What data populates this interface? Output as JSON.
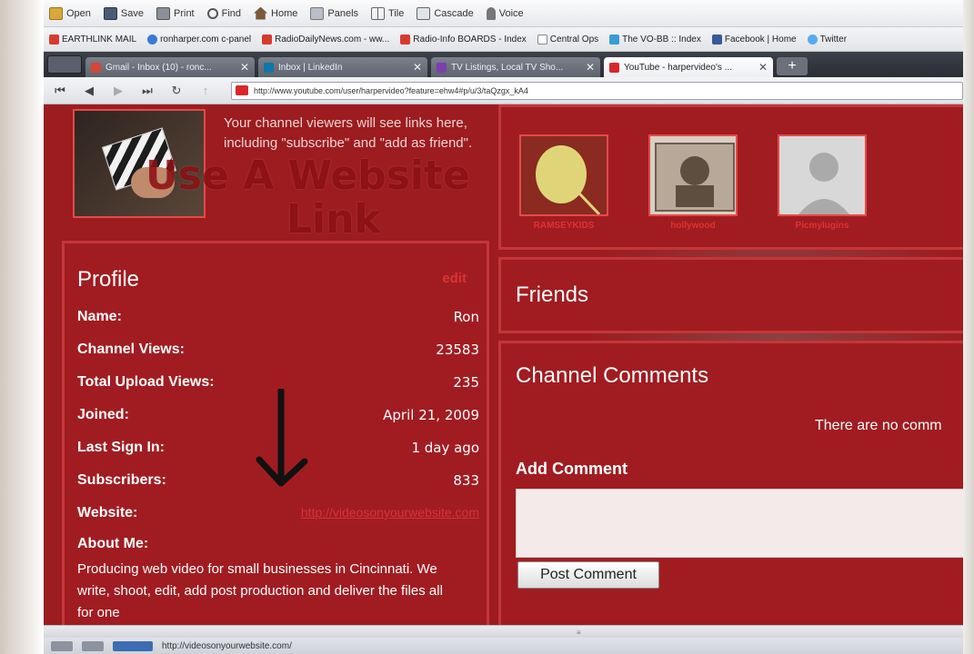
{
  "toolbar": {
    "open": "Open",
    "save": "Save",
    "print": "Print",
    "find": "Find",
    "home": "Home",
    "panels": "Panels",
    "tile": "Tile",
    "cascade": "Cascade",
    "voice": "Voice"
  },
  "bookmarks": [
    {
      "label": "EARTHLINK MAIL",
      "color": "#d83a2e"
    },
    {
      "label": "ronharper.com c-panel",
      "color": "#3a7bd5"
    },
    {
      "label": "RadioDailyNews.com - ww...",
      "color": "#d83a2e"
    },
    {
      "label": "Radio-Info BOARDS - Index",
      "color": "#d83a2e"
    },
    {
      "label": "Central Ops",
      "color": "#888888"
    },
    {
      "label": "The VO-BB :: Index",
      "color": "#3a9bd5"
    },
    {
      "label": "Facebook | Home",
      "color": "#3b5998"
    },
    {
      "label": "Twitter",
      "color": "#55acee"
    }
  ],
  "tabs": [
    {
      "label": "Gmail - Inbox (10) - ronc...",
      "color": "#d44638",
      "active": false
    },
    {
      "label": "Inbox | LinkedIn",
      "color": "#0e76a8",
      "active": false
    },
    {
      "label": "TV Listings, Local TV Sho...",
      "color": "#7b3fb0",
      "active": false
    },
    {
      "label": "YouTube - harpervideo's ...",
      "color": "#d8282a",
      "active": true
    }
  ],
  "address": {
    "url": "http://www.youtube.com/user/harpervideo?feature=ehw4#p/u/3/taQzgx_kA4"
  },
  "channel": {
    "intro": "Your channel viewers will see links here, including \"subscribe\" and \"add as friend\".",
    "overlay_line1": "Use A Website",
    "overlay_line2": "Link"
  },
  "profile": {
    "title": "Profile",
    "edit": "edit",
    "rows": [
      {
        "key": "Name:",
        "value": "Ron"
      },
      {
        "key": "Channel Views:",
        "value": "23583"
      },
      {
        "key": "Total Upload Views:",
        "value": "235"
      },
      {
        "key": "Joined:",
        "value": "April 21, 2009"
      },
      {
        "key": "Last Sign In:",
        "value": "1 day ago"
      },
      {
        "key": "Subscribers:",
        "value": "833"
      }
    ],
    "website_key": "Website:",
    "website_value": "http://videosonyourwebsite.com",
    "about_key": "About Me:",
    "about_value": "Producing web video for small businesses in Cincinnati. We write, shoot, edit, add post production and deliver the files all for one"
  },
  "subscriptions": [
    {
      "name": "RAMSEYKIDS"
    },
    {
      "name": "hollywood"
    },
    {
      "name": "Picmylugins"
    }
  ],
  "friends": {
    "title": "Friends"
  },
  "comments": {
    "title": "Channel Comments",
    "empty": "There are no comm",
    "add_label": "Add Comment",
    "post_button": "Post Comment"
  },
  "status": {
    "url": "http://videosonyourwebsite.com/"
  }
}
